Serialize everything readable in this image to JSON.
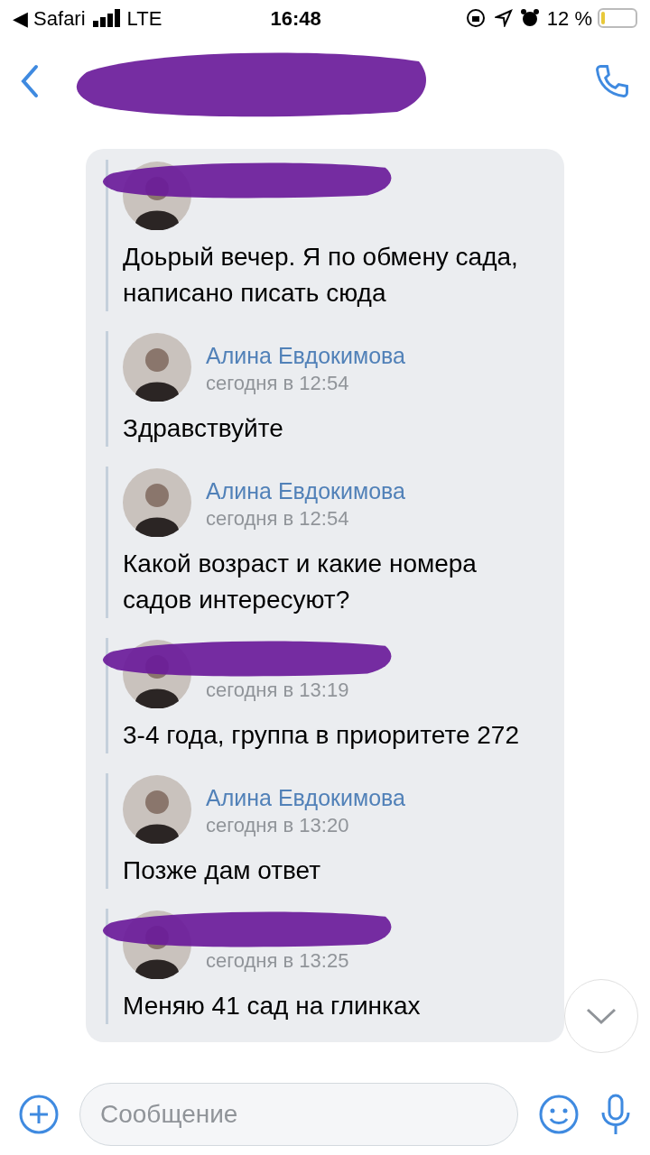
{
  "status_bar": {
    "back_app": "◀ Safari",
    "network": "LTE",
    "time": "16:48",
    "battery": "12 %"
  },
  "header": {
    "title_redacted": true
  },
  "messages": [
    {
      "redacted": true,
      "text": "Доьрый вечер. Я по обмену сада, написано писать сюда"
    },
    {
      "redacted": false,
      "author": "Алина Евдокимова",
      "time": "сегодня в 12:54",
      "text": "Здравствуйте"
    },
    {
      "redacted": false,
      "author": "Алина Евдокимова",
      "time": "сегодня в 12:54",
      "text": "Какой возраст и какие номера садов интересуют?"
    },
    {
      "redacted": true,
      "time": "сегодня в 13:19",
      "text": "3-4 года, группа в приоритете 272"
    },
    {
      "redacted": false,
      "author": "Алина Евдокимова",
      "time": "сегодня в 13:20",
      "text": "Позже дам ответ"
    },
    {
      "redacted": true,
      "time": "сегодня в 13:25",
      "text": "Меняю 41 сад на глинках"
    }
  ],
  "composer": {
    "placeholder": "Сообщение"
  }
}
